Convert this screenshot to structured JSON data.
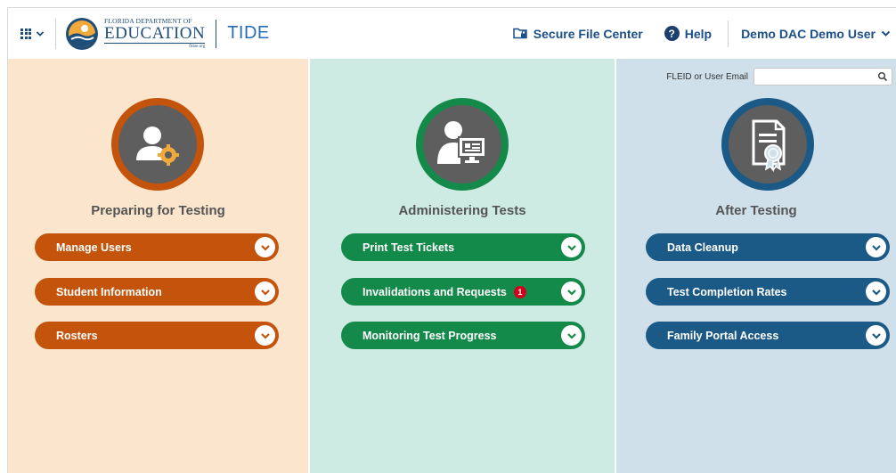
{
  "header": {
    "logo": {
      "line1": "FLORIDA DEPARTMENT OF",
      "line2": "EDUCATION",
      "line3": "fldoe.org"
    },
    "app_name": "TIDE",
    "secure_file_center": "Secure File Center",
    "help": "Help",
    "user": "Demo DAC Demo User"
  },
  "search": {
    "label": "FLEID or User Email",
    "value": "",
    "placeholder": ""
  },
  "columns": [
    {
      "title": "Preparing for Testing",
      "color": "#c4540c",
      "icon": "user-gear-icon",
      "items": [
        {
          "label": "Manage Users"
        },
        {
          "label": "Student Information"
        },
        {
          "label": "Rosters"
        }
      ]
    },
    {
      "title": "Administering Tests",
      "color": "#148a4a",
      "icon": "user-monitor-icon",
      "items": [
        {
          "label": "Print Test Tickets"
        },
        {
          "label": "Invalidations and Requests",
          "badge": "1"
        },
        {
          "label": "Monitoring Test Progress"
        }
      ]
    },
    {
      "title": "After Testing",
      "color": "#1b5a86",
      "icon": "certificate-icon",
      "items": [
        {
          "label": "Data Cleanup"
        },
        {
          "label": "Test Completion Rates"
        },
        {
          "label": "Family Portal Access"
        }
      ]
    }
  ],
  "colors": {
    "prep_bg": "#fbe6cd",
    "admin_bg": "#cdeae3",
    "after_bg": "#cfe0ea",
    "header_text": "#1b4f8a"
  }
}
